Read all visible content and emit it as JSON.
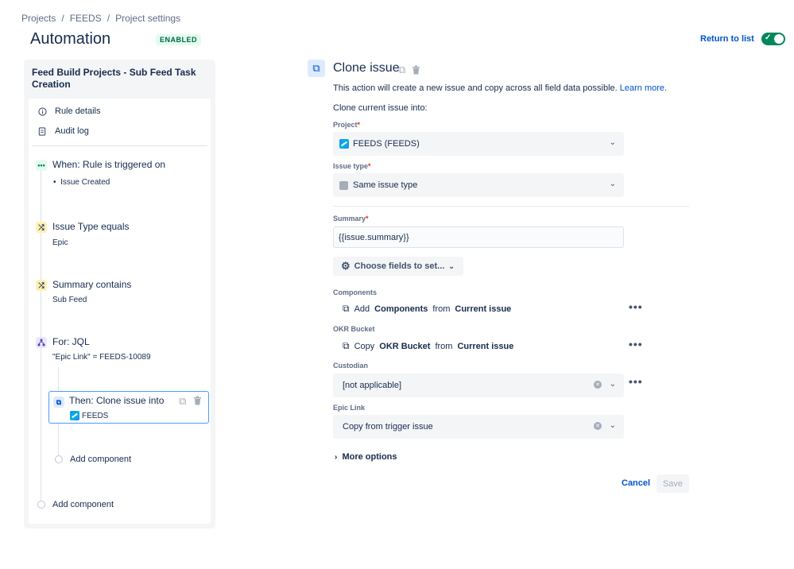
{
  "breadcrumb": {
    "items": [
      "Projects",
      "FEEDS",
      "Project settings"
    ]
  },
  "header": {
    "title": "Automation",
    "status": "ENABLED",
    "return_label": "Return to list"
  },
  "sidebar": {
    "title": "Feed Build Projects - Sub Feed Task Creation",
    "menu": [
      {
        "label": "Rule details",
        "icon": "info-icon"
      },
      {
        "label": "Audit log",
        "icon": "document-icon"
      }
    ],
    "trigger": {
      "title": "When: Rule is triggered on",
      "detail": "Issue Created"
    },
    "conditions": [
      {
        "title": "Issue Type equals",
        "detail": "Epic"
      },
      {
        "title": "Summary contains",
        "detail": "Sub Feed"
      }
    ],
    "branch": {
      "title": "For: JQL",
      "detail": "\"Epic Link\" = FEEDS-10089"
    },
    "action": {
      "title": "Then: Clone issue into",
      "detail": "FEEDS"
    },
    "add_component_inner": "Add component",
    "add_component_outer": "Add component"
  },
  "main": {
    "title": "Clone issue",
    "description": "This action will create a new issue and copy across all field data possible.",
    "learn_more": "Learn more.",
    "clone_into": "Clone current issue into:",
    "project": {
      "label": "Project",
      "value": "FEEDS (FEEDS)"
    },
    "issue_type": {
      "label": "Issue type",
      "value": "Same issue type"
    },
    "summary": {
      "label": "Summary",
      "value": "{{issue.summary}}"
    },
    "choose_fields": "Choose fields to set...",
    "components": {
      "label": "Components",
      "prefix": "Add",
      "field": "Components",
      "middle": "from",
      "source": "Current issue"
    },
    "okr": {
      "label": "OKR Bucket",
      "prefix": "Copy",
      "field": "OKR Bucket",
      "middle": "from",
      "source": "Current issue"
    },
    "custodian": {
      "label": "Custodian",
      "value": "[not applicable]"
    },
    "epic_link": {
      "label": "Epic Link",
      "value": "Copy from trigger issue"
    },
    "more_options": "More options",
    "cancel": "Cancel",
    "save": "Save"
  },
  "colors": {
    "accent": "#0052cc",
    "enabled_green": "#00875a",
    "selection": "#4c9aff"
  }
}
